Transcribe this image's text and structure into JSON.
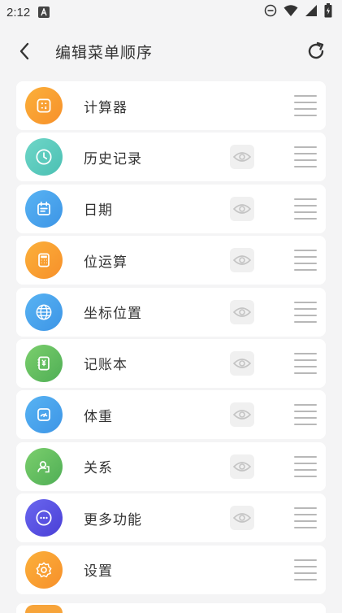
{
  "status_bar": {
    "time": "2:12"
  },
  "header": {
    "title": "编辑菜单顺序"
  },
  "items": [
    {
      "label": "计算器",
      "icon": "calculator-icon",
      "colors": [
        "#fbb03b",
        "#f7902a"
      ],
      "eye": false
    },
    {
      "label": "历史记录",
      "icon": "clock-icon",
      "colors": [
        "#6fd6c8",
        "#4bc0b3"
      ],
      "eye": true
    },
    {
      "label": "日期",
      "icon": "calendar-icon",
      "colors": [
        "#58b3f3",
        "#3d95e6"
      ],
      "eye": true
    },
    {
      "label": "位运算",
      "icon": "bit-calculator-icon",
      "colors": [
        "#fbb03b",
        "#f7902a"
      ],
      "eye": true
    },
    {
      "label": "坐标位置",
      "icon": "globe-icon",
      "colors": [
        "#58b3f3",
        "#3d95e6"
      ],
      "eye": true
    },
    {
      "label": "记账本",
      "icon": "account-book-icon",
      "colors": [
        "#7bcf6d",
        "#4fae55"
      ],
      "eye": true
    },
    {
      "label": "体重",
      "icon": "scale-icon",
      "colors": [
        "#58b3f3",
        "#3d95e6"
      ],
      "eye": true
    },
    {
      "label": "关系",
      "icon": "relationship-icon",
      "colors": [
        "#7bcf6d",
        "#4fae55"
      ],
      "eye": true
    },
    {
      "label": "更多功能",
      "icon": "more-icon",
      "colors": [
        "#6a67ef",
        "#4a3fd6"
      ],
      "eye": true
    },
    {
      "label": "设置",
      "icon": "gear-icon",
      "colors": [
        "#fbb03b",
        "#f7902a"
      ],
      "eye": false
    }
  ]
}
